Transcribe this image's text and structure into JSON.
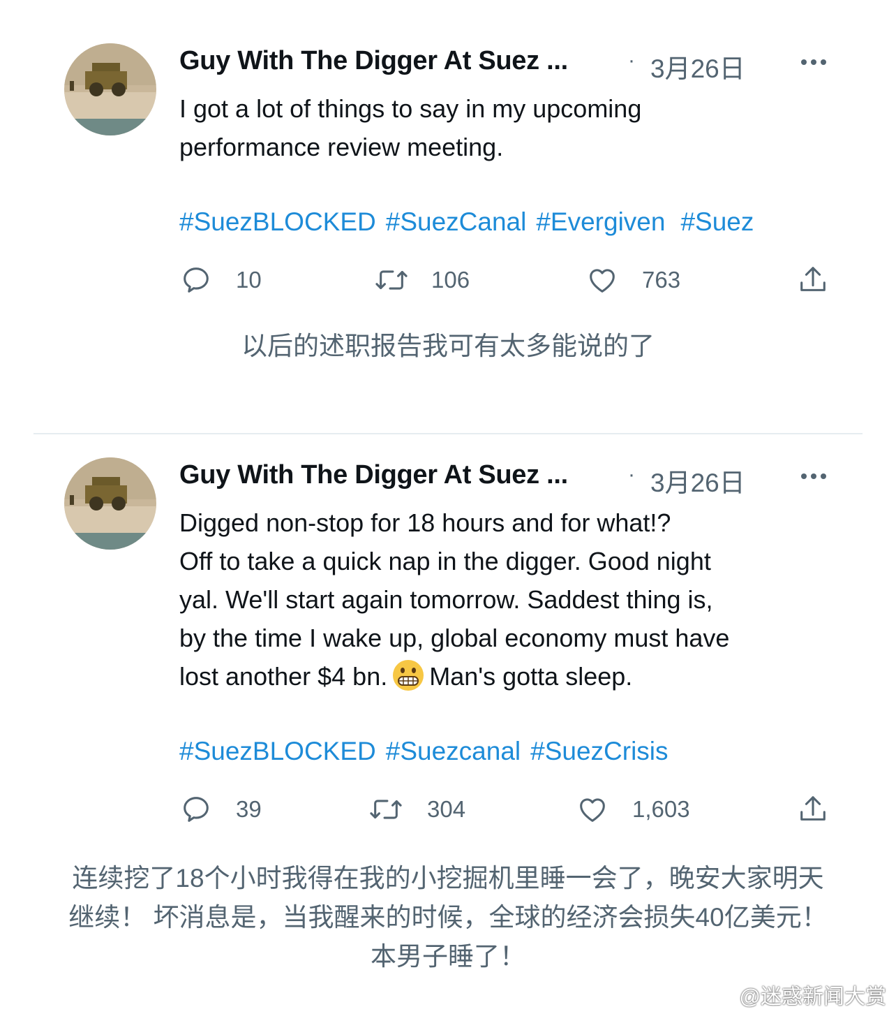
{
  "tweets": [
    {
      "name": "Guy With The Digger At Suez ...",
      "date": "3月26日",
      "text": "I got a lot of things to say in my upcoming\nperformance review meeting.",
      "hashtags": [
        "#SuezBLOCKED",
        "#SuezCanal",
        "#Evergiven",
        "#Suez"
      ],
      "replies": "10",
      "retweets": "106",
      "likes": "763",
      "caption": "以后的述职报告我可有太多能说的了"
    },
    {
      "name": "Guy With The Digger At Suez ...",
      "date": "3月26日",
      "text_before_emoji": "Digged non-stop for 18 hours and for what!?\nOff to take a quick nap in the digger. Good night\nyal. We'll start again tomorrow. Saddest thing is,\nby the time I wake up, global economy must have\nlost another $4 bn.",
      "text_after_emoji": "Man's gotta sleep.",
      "hashtags": [
        "#SuezBLOCKED",
        "#Suezcanal",
        "#SuezCrisis"
      ],
      "replies": "39",
      "retweets": "304",
      "likes": "1,603",
      "caption_lines": [
        "连续挖了18个小时我得在我的小挖掘机里睡一会了，晚安大家明天",
        "继续！ 坏消息是，当我醒来的时候，全球的经济会损失40亿美元！",
        "本男子睡了！"
      ]
    }
  ],
  "watermark": "@迷惑新闻大赏",
  "colors": {
    "hashtag": "#1d8bd8",
    "muted": "#536471",
    "text": "#0f1419"
  }
}
